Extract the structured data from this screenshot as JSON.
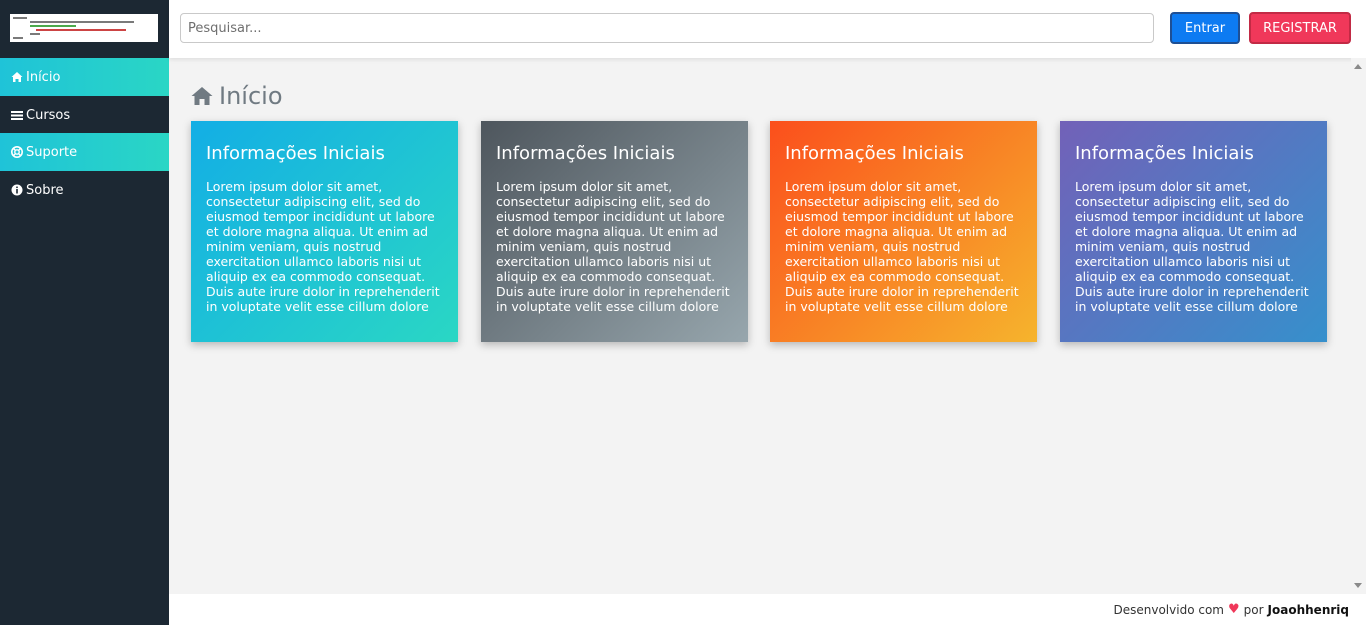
{
  "sidebar": {
    "items": [
      {
        "label": "Início",
        "icon": "home-icon",
        "active": true
      },
      {
        "label": "Cursos",
        "icon": "bars-icon",
        "active": false
      },
      {
        "label": "Suporte",
        "icon": "lifebuoy-icon",
        "active": true
      },
      {
        "label": "Sobre",
        "icon": "info-icon",
        "active": false
      }
    ]
  },
  "topbar": {
    "search_placeholder": "Pesquisar...",
    "login_label": "Entrar",
    "register_label": "REGISTRAR"
  },
  "main": {
    "title": "Início",
    "cards": [
      {
        "title": "Informações Iniciais",
        "text": "Lorem ipsum dolor sit amet, consectetur adipiscing elit, sed do eiusmod tempor incididunt ut labore et dolore magna aliqua. Ut enim ad minim veniam, quis nostrud exercitation ullamco laboris nisi ut aliquip ex ea commodo consequat. Duis aute irure dolor in reprehenderit in voluptate velit esse cillum dolore"
      },
      {
        "title": "Informações Iniciais",
        "text": "Lorem ipsum dolor sit amet, consectetur adipiscing elit, sed do eiusmod tempor incididunt ut labore et dolore magna aliqua. Ut enim ad minim veniam, quis nostrud exercitation ullamco laboris nisi ut aliquip ex ea commodo consequat. Duis aute irure dolor in reprehenderit in voluptate velit esse cillum dolore"
      },
      {
        "title": "Informações Iniciais",
        "text": "Lorem ipsum dolor sit amet, consectetur adipiscing elit, sed do eiusmod tempor incididunt ut labore et dolore magna aliqua. Ut enim ad minim veniam, quis nostrud exercitation ullamco laboris nisi ut aliquip ex ea commodo consequat. Duis aute irure dolor in reprehenderit in voluptate velit esse cillum dolore"
      },
      {
        "title": "Informações Iniciais",
        "text": "Lorem ipsum dolor sit amet, consectetur adipiscing elit, sed do eiusmod tempor incididunt ut labore et dolore magna aliqua. Ut enim ad minim veniam, quis nostrud exercitation ullamco laboris nisi ut aliquip ex ea commodo consequat. Duis aute irure dolor in reprehenderit in voluptate velit esse cillum dolore"
      }
    ]
  },
  "footer": {
    "prefix": "Desenvolvido com",
    "middle": "por",
    "author": "Joaohhenriq"
  },
  "colors": {
    "sidebar_bg": "#1c2833",
    "active_item": "#2ad6c5",
    "login_button": "#0d7bf2",
    "register_button": "#f0385a",
    "heart": "#f0385a"
  }
}
